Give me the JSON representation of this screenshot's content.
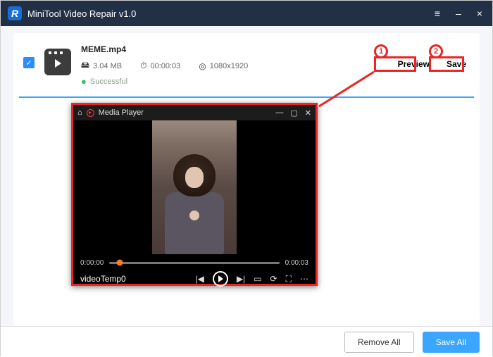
{
  "app": {
    "logo_letter": "R",
    "title": "MiniTool Video Repair v1.0"
  },
  "title_controls": {
    "menu": "≡",
    "minimize": "–",
    "close": "×"
  },
  "file": {
    "name": "MEME.mp4",
    "size": "3.04 MB",
    "duration": "00:00:03",
    "resolution": "1080x1920",
    "status": "Successful",
    "checked": true
  },
  "file_actions": {
    "preview": "Preview",
    "save": "Save"
  },
  "media_player": {
    "title": "Media Player",
    "win": {
      "min": "—",
      "max": "▢",
      "close": "✕"
    },
    "time_current": "0:00:00",
    "time_total": "0:00:03",
    "filename": "videoTemp0",
    "icons": {
      "prev": "|◀",
      "next": "▶|",
      "pip": "▭",
      "cast": "⟳",
      "full": "⛶",
      "more": "⋯"
    }
  },
  "callouts": {
    "one": "1",
    "two": "2"
  },
  "bottom": {
    "remove_all": "Remove All",
    "save_all": "Save All"
  }
}
